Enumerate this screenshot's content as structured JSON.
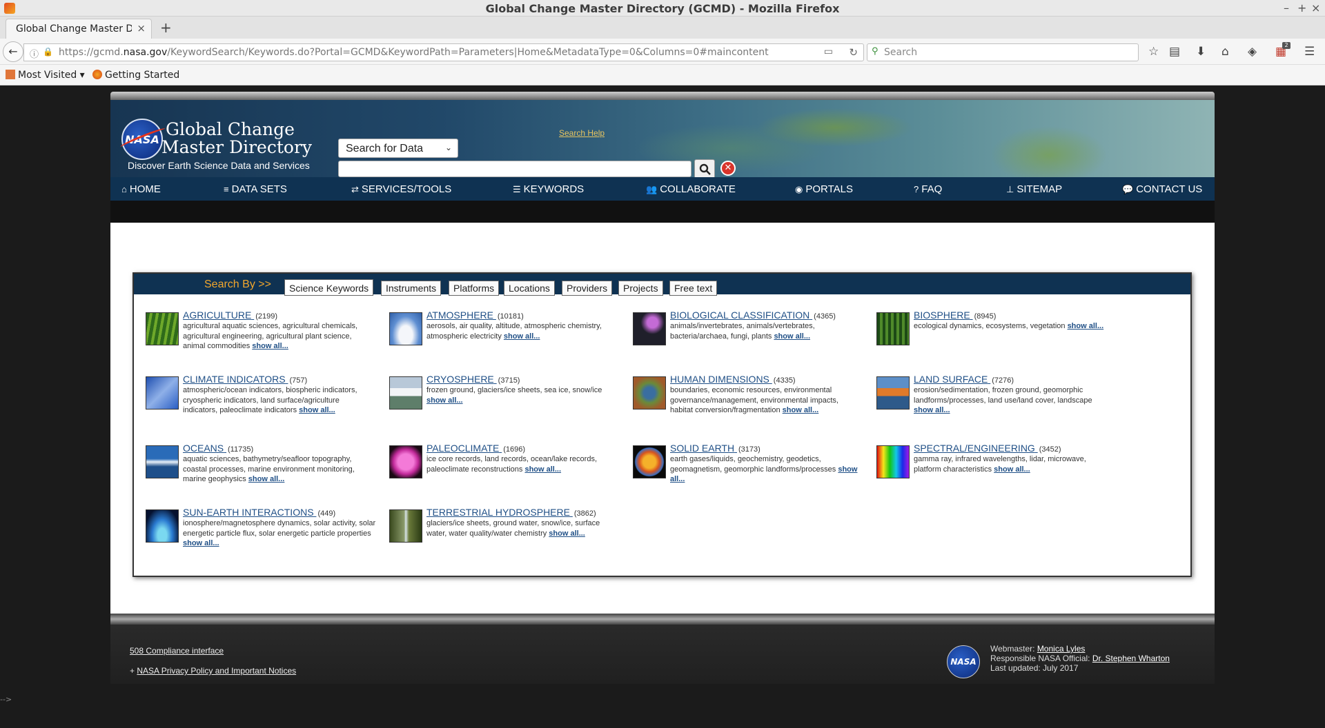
{
  "window": {
    "title": "Global Change Master Directory (GCMD) - Mozilla Firefox"
  },
  "tab": {
    "label": "Global Change Master Dir"
  },
  "navbar": {
    "url_prefix": "https://gcmd.",
    "url_domain": "nasa.gov",
    "url_suffix": "/KeywordSearch/Keywords.do?Portal=GCMD&KeywordPath=Parameters|Home&MetadataType=0&Columns=0#maincontent",
    "search_placeholder": "Search",
    "badge_count": "2"
  },
  "bookmarks": {
    "most_visited": "Most Visited",
    "getting_started": "Getting Started"
  },
  "header": {
    "brand_line1": "Global Change",
    "brand_line2": "Master Directory",
    "tagline": "Discover Earth Science Data and Services",
    "logo_text": "NASA",
    "search_select_value": "Search for Data",
    "search_help": "Search Help"
  },
  "nav": {
    "home": "HOME",
    "datasets": "DATA SETS",
    "services": "SERVICES/TOOLS",
    "keywords": "KEYWORDS",
    "collaborate": "COLLABORATE",
    "portals": "PORTALS",
    "faq": "FAQ",
    "sitemap": "SITEMAP",
    "contact": "CONTACT US"
  },
  "searchby": {
    "label": "Search By >>",
    "tabs": [
      "Science Keywords",
      "Instruments",
      "Platforms",
      "Locations",
      "Providers",
      "Projects",
      "Free text"
    ]
  },
  "keywords": [
    {
      "name": "AGRICULTURE",
      "count": "(2199)",
      "desc": "agricultural aquatic sciences, agricultural chemicals, agricultural engineering, agricultural plant science, animal commodities",
      "more": "show all..."
    },
    {
      "name": "ATMOSPHERE",
      "count": "(10181)",
      "desc": "aerosols, air quality, altitude, atmospheric chemistry, atmospheric electricity",
      "more": "show all..."
    },
    {
      "name": "BIOLOGICAL CLASSIFICATION",
      "count": "(4365)",
      "desc": "animals/invertebrates, animals/vertebrates, bacteria/archaea, fungi, plants",
      "more": "show all..."
    },
    {
      "name": "BIOSPHERE",
      "count": "(8945)",
      "desc": "ecological dynamics, ecosystems, vegetation",
      "more": "show all..."
    },
    {
      "name": "CLIMATE INDICATORS",
      "count": "(757)",
      "desc": "atmospheric/ocean indicators, biospheric indicators, cryospheric indicators, land surface/agriculture indicators, paleoclimate indicators",
      "more": "show all..."
    },
    {
      "name": "CRYOSPHERE",
      "count": "(3715)",
      "desc": "frozen ground, glaciers/ice sheets, sea ice, snow/ice",
      "more": "show all..."
    },
    {
      "name": "HUMAN DIMENSIONS",
      "count": "(4335)",
      "desc": "boundaries, economic resources, environmental governance/management, environmental impacts, habitat conversion/fragmentation",
      "more": "show all..."
    },
    {
      "name": "LAND SURFACE",
      "count": "(7276)",
      "desc": "erosion/sedimentation, frozen ground, geomorphic landforms/processes, land use/land cover, landscape",
      "more": "show all..."
    },
    {
      "name": "OCEANS",
      "count": "(11735)",
      "desc": "aquatic sciences, bathymetry/seafloor topography, coastal processes, marine environment monitoring, marine geophysics",
      "more": "show all..."
    },
    {
      "name": "PALEOCLIMATE",
      "count": "(1696)",
      "desc": "ice core records, land records, ocean/lake records, paleoclimate reconstructions",
      "more": "show all..."
    },
    {
      "name": "SOLID EARTH",
      "count": "(3173)",
      "desc": "earth gases/liquids, geochemistry, geodetics, geomagnetism, geomorphic landforms/processes",
      "more": "show all..."
    },
    {
      "name": "SPECTRAL/ENGINEERING",
      "count": "(3452)",
      "desc": "gamma ray, infrared wavelengths, lidar, microwave, platform characteristics",
      "more": "show all..."
    },
    {
      "name": "SUN-EARTH INTERACTIONS",
      "count": "(449)",
      "desc": "ionosphere/magnetosphere dynamics, solar activity, solar energetic particle flux, solar energetic particle properties",
      "more": "show all..."
    },
    {
      "name": "TERRESTRIAL HYDROSPHERE",
      "count": "(3862)",
      "desc": "glaciers/ice sheets, ground water, snow/ice, surface water, water quality/water chemistry",
      "more": "show all..."
    }
  ],
  "footer": {
    "compliance": "508 Compliance interface",
    "privacy_prefix": "+",
    "privacy": "NASA Privacy Policy and Important Notices",
    "webmaster_label": "Webmaster:",
    "webmaster": "Monica Lyles",
    "official_label": "Responsible NASA Official:",
    "official": "Dr. Stephen Wharton",
    "updated": "Last updated: July 2017",
    "logo_text": "NASA"
  },
  "stray_text": "-->",
  "colors": {
    "nav_bg": "#0f3252",
    "link": "#1f4f86",
    "searchby": "#f3a72c",
    "help": "#e8c560"
  }
}
